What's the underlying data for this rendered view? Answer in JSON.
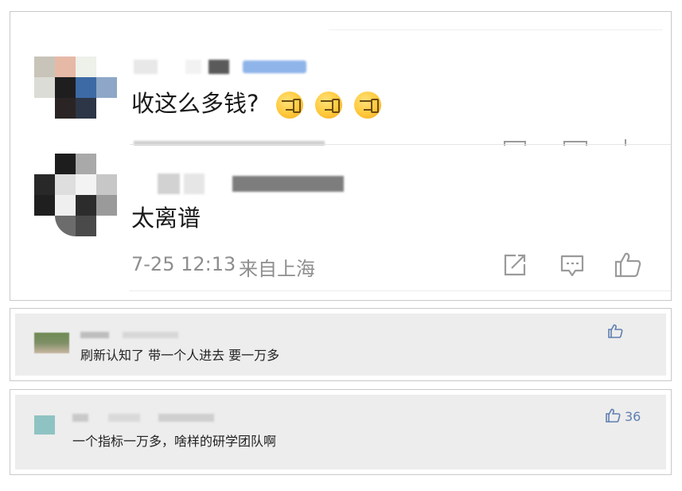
{
  "comments": [
    {
      "text": "收这么多钱?",
      "emojis": [
        "smirk-face-icon",
        "smirk-face-icon",
        "smirk-face-icon"
      ]
    },
    {
      "text": "太离谱",
      "date": "7-25 12:13",
      "location": "来自上海"
    }
  ],
  "replies": [
    {
      "text": "刷新认知了 带一个人进去 要一万多",
      "likes": ""
    },
    {
      "text": "一个指标一万多，啥样的研学团队啊",
      "likes": "36"
    }
  ],
  "colors": {
    "text": "#1a1a1a",
    "meta": "#8e8e8e",
    "icon": "#9a9a9a",
    "like_blue": "#5f7fb0",
    "card_bg": "#ededed"
  }
}
